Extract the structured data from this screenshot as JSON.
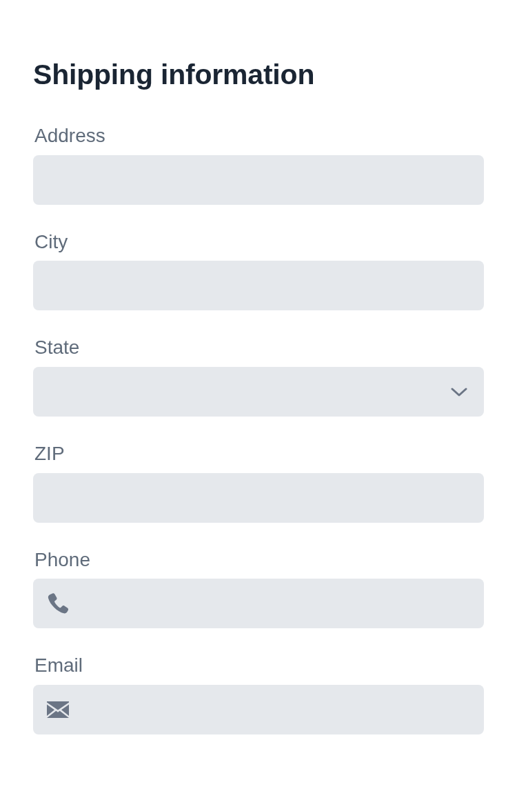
{
  "title": "Shipping information",
  "fields": [
    {
      "label": "Address",
      "kind": "text"
    },
    {
      "label": "City",
      "kind": "text"
    },
    {
      "label": "State",
      "kind": "select"
    },
    {
      "label": "ZIP",
      "kind": "text"
    },
    {
      "label": "Phone",
      "kind": "phone"
    },
    {
      "label": "Email",
      "kind": "email"
    }
  ]
}
